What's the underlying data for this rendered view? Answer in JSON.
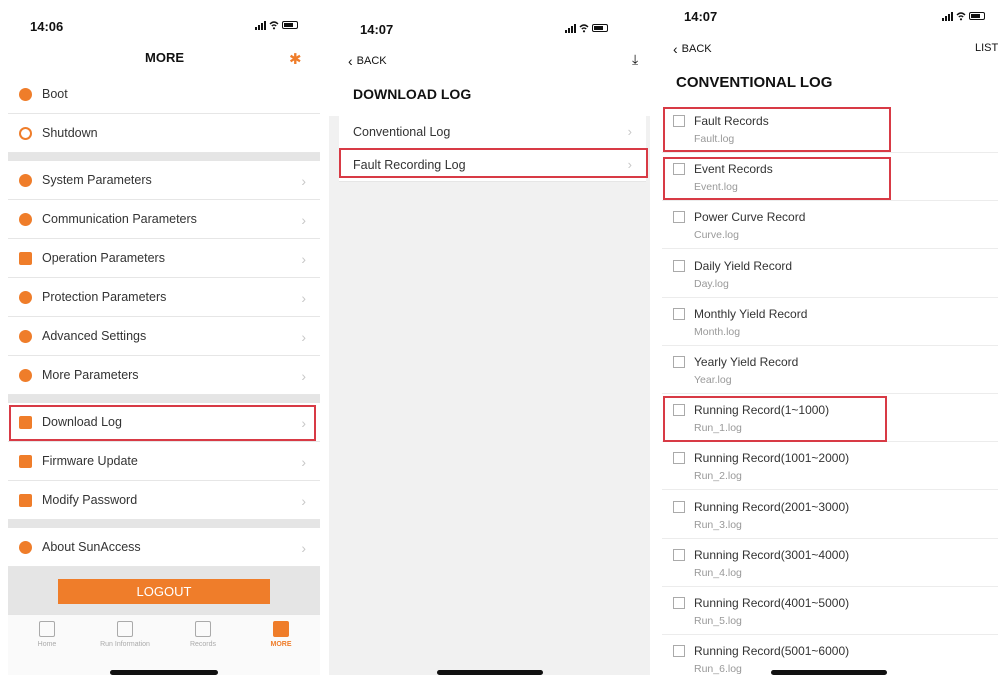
{
  "panel1": {
    "time": "14:06",
    "title": "MORE",
    "groups": [
      [
        {
          "label": "Boot",
          "icon": "play-icon"
        },
        {
          "label": "Shutdown",
          "icon": "power-icon"
        }
      ],
      [
        {
          "label": "System Parameters",
          "icon": "gear-icon"
        },
        {
          "label": "Communication Parameters",
          "icon": "chat-icon"
        },
        {
          "label": "Operation Parameters",
          "icon": "chart-icon"
        },
        {
          "label": "Protection Parameters",
          "icon": "umbrella-icon"
        },
        {
          "label": "Advanced Settings",
          "icon": "cog-icon"
        },
        {
          "label": "More Parameters",
          "icon": "settings-icon"
        }
      ],
      [
        {
          "label": "Download Log",
          "icon": "clipboard-icon"
        },
        {
          "label": "Firmware Update",
          "icon": "package-icon"
        },
        {
          "label": "Modify Password",
          "icon": "lock-icon"
        }
      ],
      [
        {
          "label": "About SunAccess",
          "icon": "info-icon"
        }
      ]
    ],
    "logout": "LOGOUT",
    "tabs": [
      {
        "label": "Home",
        "icon": "home-icon",
        "active": false
      },
      {
        "label": "Run Information",
        "icon": "monitor-icon",
        "active": false
      },
      {
        "label": "Records",
        "icon": "records-icon",
        "active": false
      },
      {
        "label": "MORE",
        "icon": "more-icon",
        "active": true
      }
    ]
  },
  "panel2": {
    "time": "14:07",
    "back": "BACK",
    "title": "DOWNLOAD LOG",
    "items": [
      "Conventional Log",
      "Fault Recording Log"
    ]
  },
  "panel3": {
    "time": "14:07",
    "back": "BACK",
    "list_button": "LIST",
    "title": "CONVENTIONAL LOG",
    "items": [
      {
        "name": "Fault Records",
        "file": "Fault.log"
      },
      {
        "name": "Event Records",
        "file": "Event.log"
      },
      {
        "name": "Power Curve Record",
        "file": "Curve.log"
      },
      {
        "name": "Daily Yield Record",
        "file": "Day.log"
      },
      {
        "name": "Monthly Yield Record",
        "file": "Month.log"
      },
      {
        "name": "Yearly Yield Record",
        "file": "Year.log"
      },
      {
        "name": "Running Record(1~1000)",
        "file": "Run_1.log"
      },
      {
        "name": "Running Record(1001~2000)",
        "file": "Run_2.log"
      },
      {
        "name": "Running Record(2001~3000)",
        "file": "Run_3.log"
      },
      {
        "name": "Running Record(3001~4000)",
        "file": "Run_4.log"
      },
      {
        "name": "Running Record(4001~5000)",
        "file": "Run_5.log"
      },
      {
        "name": "Running Record(5001~6000)",
        "file": "Run_6.log"
      }
    ]
  },
  "colors": {
    "accent": "#ef7d2a",
    "highlight": "#d83a45"
  }
}
